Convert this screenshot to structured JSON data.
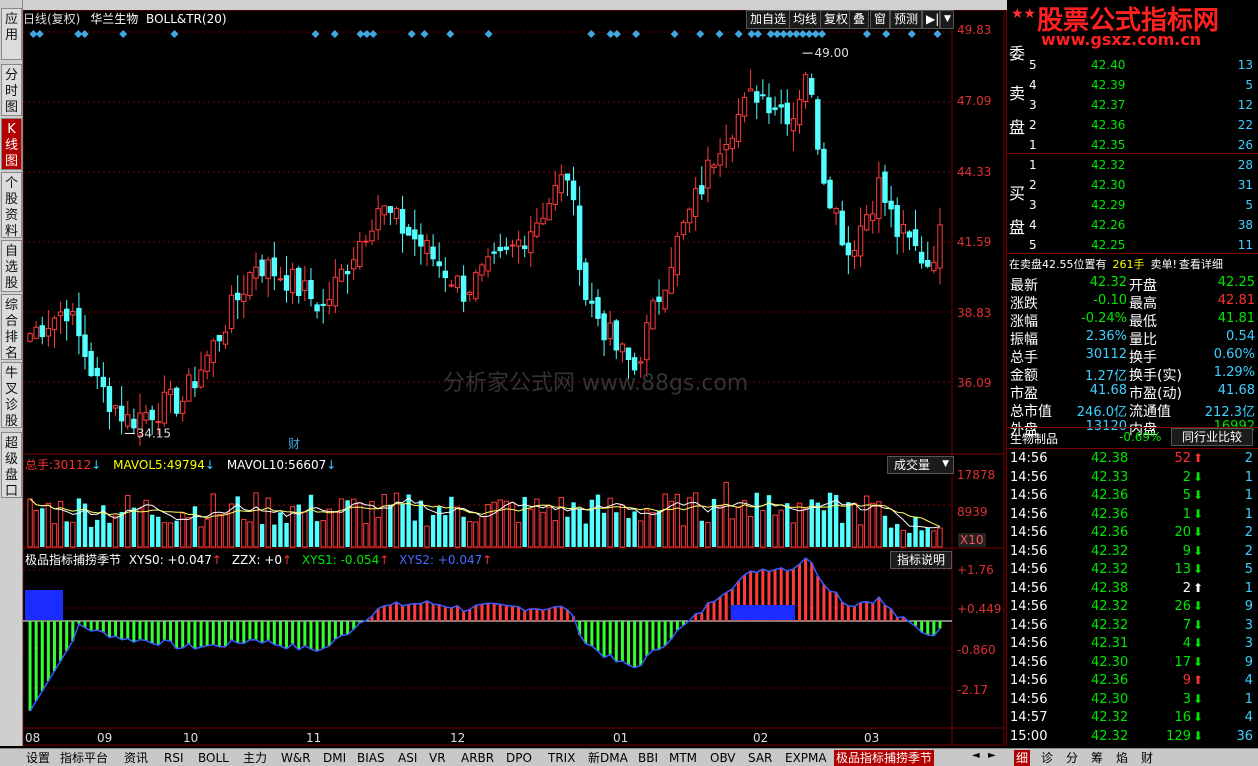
{
  "left_tabs": [
    {
      "label": "应用"
    },
    {
      "label": "分时图"
    },
    {
      "label": "K线图"
    },
    {
      "label": "个股资料"
    },
    {
      "label": "自选股"
    },
    {
      "label": "综合排名"
    },
    {
      "label": "牛叉诊股"
    },
    {
      "label": "超级盘口"
    }
  ],
  "header": {
    "title": "日线(复权)",
    "stock_name": "华兰生物",
    "indicator": "BOLL&TR(20)"
  },
  "toolbar": [
    "加自选",
    "均线",
    "复权",
    "叠",
    "窗",
    "预测"
  ],
  "price_axis": [
    "49.83",
    "47.09",
    "44.33",
    "41.59",
    "38.83",
    "36.09"
  ],
  "annotations": {
    "high": "49.00",
    "low": "34.15",
    "event": "财"
  },
  "volume": {
    "total_label": "总手:",
    "total": "30112",
    "ma5_label": "MAVOL5:",
    "ma5": "49794",
    "ma10_label": "MAVOL10:",
    "ma10": "56607",
    "dropdown": "成交量",
    "axis": [
      "17878",
      "8939",
      "X10"
    ]
  },
  "indicator": {
    "name": "极品指标捕捞季节",
    "xys0": "XYS0: +0.047",
    "zzx": "ZZX: +0",
    "xys1": "XYS1: -0.054",
    "xys2": "XYS2: +0.047",
    "button": "指标说明",
    "axis": [
      "+1.76",
      "+0.449",
      "-0.860",
      "-2.17"
    ]
  },
  "months": [
    "08",
    "09",
    "10",
    "11",
    "12",
    "01",
    "02",
    "03"
  ],
  "watermark": "分析家公式网 www.88gs.com",
  "brand": {
    "title": "股票公式指标网",
    "url": "www.gsxz.com.cn"
  },
  "orderbook": {
    "sell_label": [
      "卖",
      "盘"
    ],
    "buy_label": [
      "买",
      "盘"
    ],
    "wei": "委",
    "sells": [
      {
        "lvl": "5",
        "price": "42.40",
        "vol": "13"
      },
      {
        "lvl": "4",
        "price": "42.39",
        "vol": "5"
      },
      {
        "lvl": "3",
        "price": "42.37",
        "vol": "12"
      },
      {
        "lvl": "2",
        "price": "42.36",
        "vol": "22"
      },
      {
        "lvl": "1",
        "price": "42.35",
        "vol": "26"
      }
    ],
    "buys": [
      {
        "lvl": "1",
        "price": "42.32",
        "vol": "28"
      },
      {
        "lvl": "2",
        "price": "42.30",
        "vol": "31"
      },
      {
        "lvl": "3",
        "price": "42.29",
        "vol": "5"
      },
      {
        "lvl": "4",
        "price": "42.26",
        "vol": "38"
      },
      {
        "lvl": "5",
        "price": "42.25",
        "vol": "11"
      }
    ]
  },
  "notice": {
    "text": "在卖盘42.55位置有",
    "vol": "261手",
    "tail": "卖单!",
    "link": "查看详细"
  },
  "quote": [
    {
      "k1": "最新",
      "v1": "42.32",
      "k2": "开盘",
      "v2": "42.25"
    },
    {
      "k1": "涨跌",
      "v1": "-0.10",
      "k2": "最高",
      "v2": "42.81"
    },
    {
      "k1": "涨幅",
      "v1": "-0.24%",
      "k2": "最低",
      "v2": "41.81"
    },
    {
      "k1": "振幅",
      "v1": "2.36%",
      "k2": "量比",
      "v2": "0.54"
    },
    {
      "k1": "总手",
      "v1": "30112",
      "k2": "换手",
      "v2": "0.60%"
    },
    {
      "k1": "金额",
      "v1": "1.27亿",
      "k2": "换手(实)",
      "v2": "1.29%"
    },
    {
      "k1": "市盈",
      "v1": "41.68",
      "k2": "市盈(动)",
      "v2": "41.68"
    },
    {
      "k1": "总市值",
      "v1": "246.0亿",
      "k2": "流通值",
      "v2": "212.3亿"
    },
    {
      "k1": "外盘",
      "v1": "13120",
      "k2": "内盘",
      "v2": "16992"
    }
  ],
  "industry": {
    "name": "生物制品",
    "change": "-0.69%",
    "button": "同行业比较"
  },
  "ticks": [
    {
      "t": "14:56",
      "p": "42.38",
      "v": "52",
      "d": "up",
      "n": "2"
    },
    {
      "t": "14:56",
      "p": "42.33",
      "v": "2",
      "d": "down",
      "n": "1"
    },
    {
      "t": "14:56",
      "p": "42.36",
      "v": "5",
      "d": "down",
      "n": "1"
    },
    {
      "t": "14:56",
      "p": "42.36",
      "v": "1",
      "d": "down",
      "n": "1"
    },
    {
      "t": "14:56",
      "p": "42.36",
      "v": "20",
      "d": "down",
      "n": "2"
    },
    {
      "t": "14:56",
      "p": "42.32",
      "v": "9",
      "d": "down",
      "n": "2"
    },
    {
      "t": "14:56",
      "p": "42.32",
      "v": "13",
      "d": "down",
      "n": "5"
    },
    {
      "t": "14:56",
      "p": "42.38",
      "v": "2",
      "d": "upw",
      "n": "1"
    },
    {
      "t": "14:56",
      "p": "42.32",
      "v": "26",
      "d": "down",
      "n": "9"
    },
    {
      "t": "14:56",
      "p": "42.32",
      "v": "7",
      "d": "down",
      "n": "3"
    },
    {
      "t": "14:56",
      "p": "42.31",
      "v": "4",
      "d": "down",
      "n": "3"
    },
    {
      "t": "14:56",
      "p": "42.30",
      "v": "17",
      "d": "down",
      "n": "9"
    },
    {
      "t": "14:56",
      "p": "42.36",
      "v": "9",
      "d": "up",
      "n": "4"
    },
    {
      "t": "14:56",
      "p": "42.30",
      "v": "3",
      "d": "down",
      "n": "1"
    },
    {
      "t": "14:57",
      "p": "42.32",
      "v": "16",
      "d": "down",
      "n": "4"
    },
    {
      "t": "15:00",
      "p": "42.32",
      "v": "129",
      "d": "down",
      "n": "36"
    }
  ],
  "bottom_tabs": [
    "设置",
    "指标平台",
    "资讯",
    "RSI",
    "BOLL",
    "主力",
    "W&R",
    "DMI",
    "BIAS",
    "ASI",
    "VR",
    "ARBR",
    "DPO",
    "TRIX",
    "新DMA",
    "BBI",
    "MTM",
    "OBV",
    "SAR",
    "EXPMA",
    "极品指标捕捞季节"
  ],
  "right_bottom_tabs": [
    "细",
    "诊",
    "分",
    "筹",
    "焰",
    "财"
  ],
  "colors": {
    "up": "#ff3b3b",
    "down": "#54ffff",
    "panel_border": "#7a0000",
    "ma5": "#ffffff",
    "ma10": "#ffff66"
  }
}
